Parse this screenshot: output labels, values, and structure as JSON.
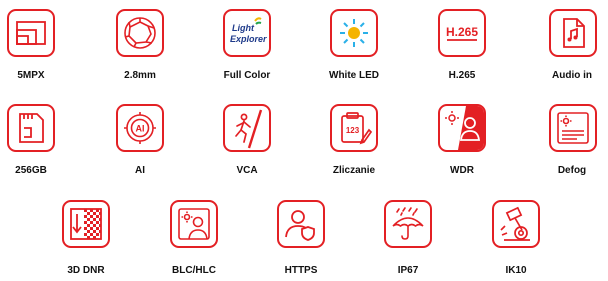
{
  "accent_color": "#e32024",
  "features": [
    {
      "label": "5MPX",
      "icon": "resolution-icon"
    },
    {
      "label": "2.8mm",
      "icon": "lens-aperture-icon"
    },
    {
      "label": "Full Color",
      "icon": "light-explorer-logo",
      "logo_text_1": "Light",
      "logo_text_2": "Explorer"
    },
    {
      "label": "White LED",
      "icon": "sun-led-icon"
    },
    {
      "label": "H.265",
      "icon": "h265-codec-icon",
      "icon_text": "H.265"
    },
    {
      "label": "Audio in",
      "icon": "audio-file-icon"
    },
    {
      "label": "256GB",
      "icon": "sd-card-icon"
    },
    {
      "label": "AI",
      "icon": "ai-chip-icon",
      "icon_text": "AI"
    },
    {
      "label": "VCA",
      "icon": "line-crossing-person-icon"
    },
    {
      "label": "Zliczanie",
      "icon": "counting-clipboard-icon",
      "icon_text": "123"
    },
    {
      "label": "WDR",
      "icon": "wdr-person-icon"
    },
    {
      "label": "Defog",
      "icon": "defog-icon"
    },
    {
      "label": "3D DNR",
      "icon": "noise-reduction-icon"
    },
    {
      "label": "BLC/HLC",
      "icon": "backlight-compensation-icon"
    },
    {
      "label": "HTTPS",
      "icon": "secure-user-icon"
    },
    {
      "label": "IP67",
      "icon": "umbrella-rain-icon"
    },
    {
      "label": "IK10",
      "icon": "vandal-hammer-icon"
    }
  ]
}
